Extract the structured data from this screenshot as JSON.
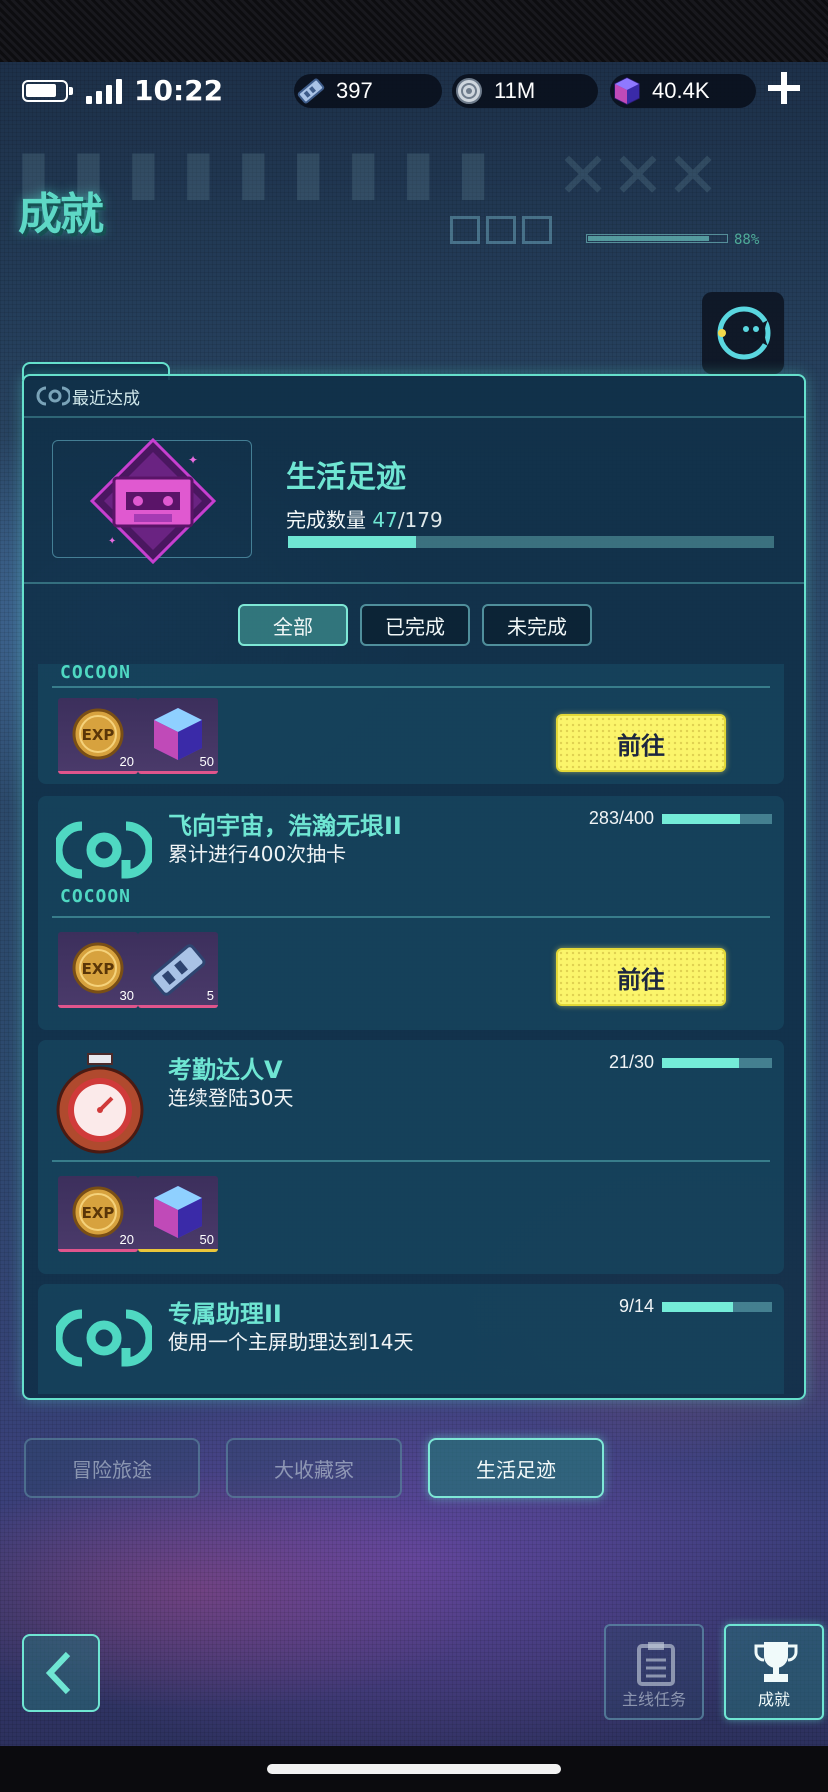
{
  "status_bar": {
    "time": "10:22"
  },
  "resources": [
    {
      "icon": "ticket-icon",
      "value": "397"
    },
    {
      "icon": "disc-icon",
      "value": "11M"
    },
    {
      "icon": "cube-gem-icon",
      "value": "40.4K"
    }
  ],
  "header": {
    "title": "成就",
    "overall_progress_label": "88%",
    "overall_progress": 0.88
  },
  "recent": {
    "label": "最近达成",
    "title": "生活足迹",
    "count_label": "完成数量",
    "count": "47",
    "total": "/179",
    "progress": 0.2626
  },
  "filters": {
    "all": "全部",
    "completed": "已完成",
    "incomplete": "未完成"
  },
  "cocoon_text": "COCOON",
  "cards": [
    {
      "rewards": [
        {
          "icon": "exp-coin-icon",
          "count": "20"
        },
        {
          "icon": "cube-gem-icon",
          "count": "50"
        }
      ],
      "go_label": "前往"
    },
    {
      "title": "飞向宇宙，浩瀚无垠II",
      "desc": "累计进行400次抽卡",
      "progress_text": "283/400",
      "progress": 0.7075,
      "rewards": [
        {
          "icon": "exp-coin-icon",
          "count": "30"
        },
        {
          "icon": "ticket-icon",
          "count": "5"
        }
      ],
      "go_label": "前往"
    },
    {
      "title": "考勤达人V",
      "desc": "连续登陆30天",
      "progress_text": "21/30",
      "progress": 0.7,
      "rewards": [
        {
          "icon": "exp-coin-icon",
          "count": "20"
        },
        {
          "icon": "cube-gem-icon",
          "count": "50"
        }
      ]
    },
    {
      "title": "专属助理II",
      "desc": "使用一个主屏助理达到14天",
      "progress_text": "9/14",
      "progress": 0.643
    }
  ],
  "category_tabs": [
    "冒险旅途",
    "大收藏家",
    "生活足迹"
  ],
  "bottom_nav": {
    "main_quest": "主线任务",
    "achievements": "成就"
  },
  "colors": {
    "accent": "#6fe6d3",
    "button_yellow": "#fbf56b",
    "panel": "#10304a"
  }
}
